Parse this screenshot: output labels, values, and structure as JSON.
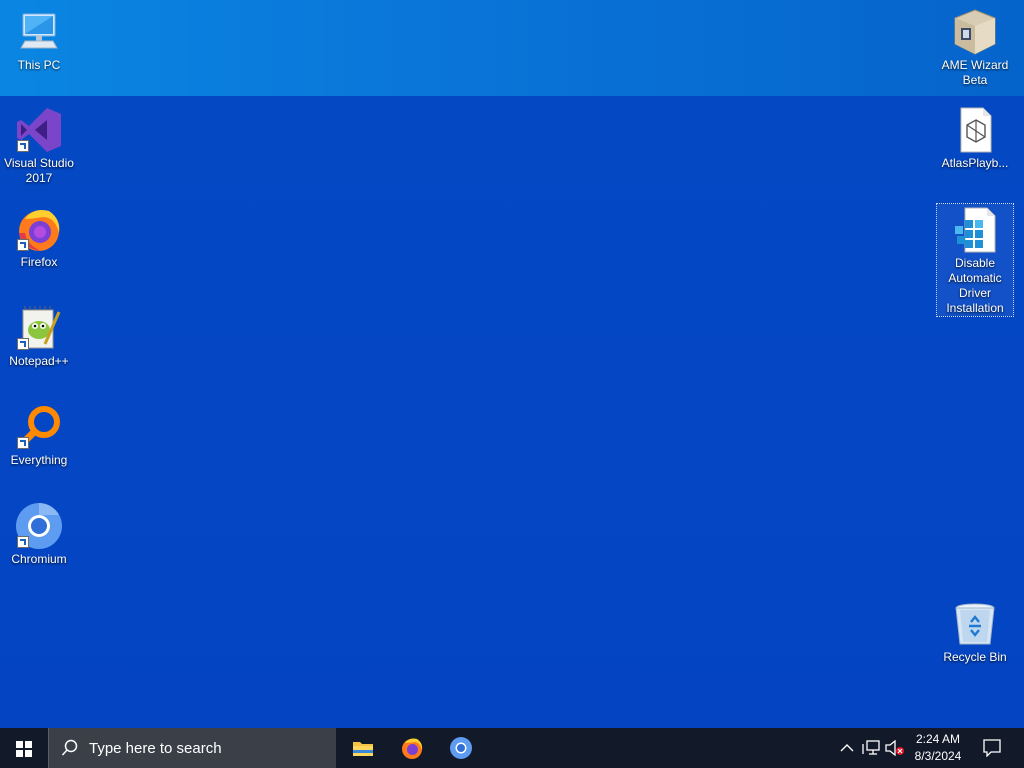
{
  "desktop": {
    "icons_left": [
      {
        "label": "This PC"
      },
      {
        "label": "Visual Studio 2017"
      },
      {
        "label": "Firefox"
      },
      {
        "label": "Notepad++"
      },
      {
        "label": "Everything"
      },
      {
        "label": "Chromium"
      }
    ],
    "icons_right": [
      {
        "label": "AME Wizard Beta"
      },
      {
        "label": "AtlasPlayb..."
      },
      {
        "label": "Disable Automatic Driver Installation"
      },
      {
        "label": "Recycle Bin"
      }
    ]
  },
  "taskbar": {
    "search_placeholder": "Type here to search",
    "pinned": [
      "file-explorer-icon",
      "firefox-icon",
      "chromium-icon"
    ],
    "clock": {
      "time": "2:24 AM",
      "date": "8/3/2024"
    }
  }
}
